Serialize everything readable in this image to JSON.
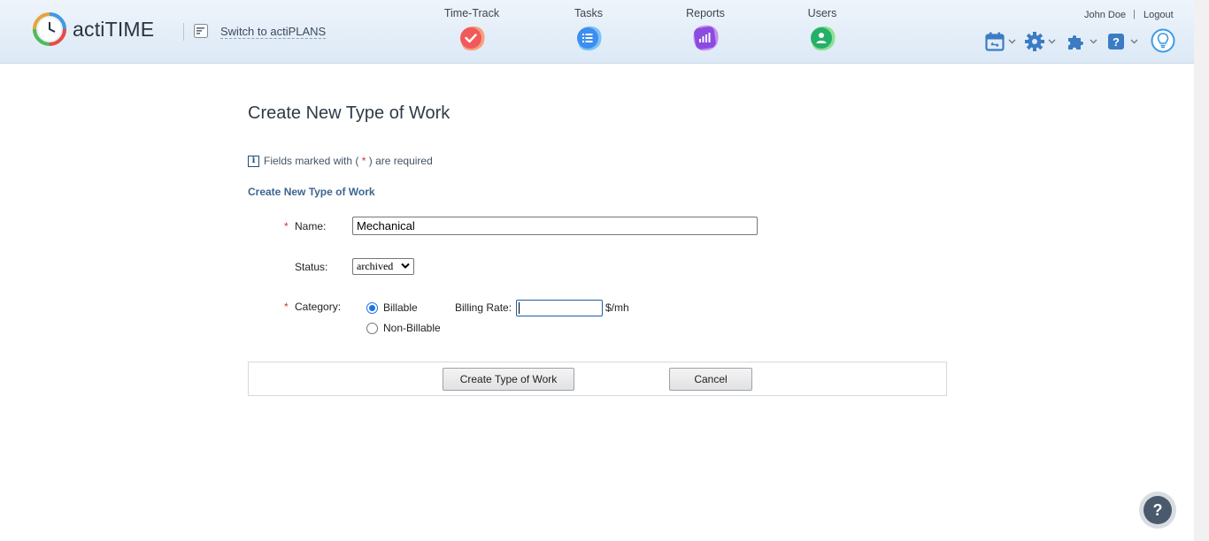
{
  "app": {
    "logo_text": "actiTIME"
  },
  "header": {
    "switch_link": "Switch to actiPLANS",
    "nav": [
      {
        "label": "Time-Track",
        "icon": "check-icon",
        "color": "#f05a5a"
      },
      {
        "label": "Tasks",
        "icon": "list-icon",
        "color": "#3d8ef0"
      },
      {
        "label": "Reports",
        "icon": "bar-chart-icon",
        "color": "#8b4be0"
      },
      {
        "label": "Users",
        "icon": "user-icon",
        "color": "#25b06a"
      }
    ],
    "user_name": "John Doe",
    "separator": "|",
    "logout": "Logout",
    "tools": [
      "calendar-icon",
      "gear-icon",
      "puzzle-icon",
      "help-icon",
      "lightbulb-icon"
    ]
  },
  "form": {
    "page_title": "Create New Type of Work",
    "required_note_prefix": "Fields marked with (",
    "required_note_star": "*",
    "required_note_suffix": ") are required",
    "section_title": "Create New Type of Work",
    "name_label": "Name:",
    "name_value": "Mechanical",
    "status_label": "Status:",
    "status_value": "archived",
    "category_label": "Category:",
    "billable_label": "Billable",
    "non_billable_label": "Non-Billable",
    "billing_rate_label": "Billing Rate:",
    "billing_rate_value": "",
    "rate_unit": "$/mh",
    "required_star": "*",
    "category_selected": "Billable"
  },
  "buttons": {
    "create": "Create Type of Work",
    "cancel": "Cancel"
  },
  "help_fab": "?",
  "colors": {
    "accent": "#3d6690",
    "required": "#d13030",
    "header_bg": "#dce9f6"
  }
}
